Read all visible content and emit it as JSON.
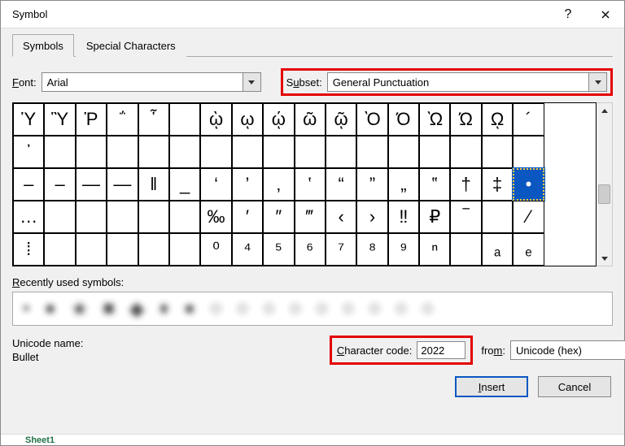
{
  "window": {
    "title": "Symbol"
  },
  "tabs": {
    "symbols": "Symbols",
    "special": "Special Characters"
  },
  "font": {
    "label": "Font:",
    "value": "Arial"
  },
  "subset": {
    "label": "Subset:",
    "value": "General Punctuation"
  },
  "grid": {
    "rows": [
      [
        "Ὑ",
        "Ὓ",
        "Ῥ",
        "΅",
        "῟",
        "",
        "ῲ",
        "ῳ",
        "ῴ",
        "ῶ",
        "ῷ",
        "Ὸ",
        "Ό",
        "Ὼ",
        "Ώ",
        "ῼ",
        "´"
      ],
      [
        "᾿",
        "",
        "",
        "",
        "",
        "",
        "",
        "",
        "",
        "",
        "",
        "",
        "",
        "",
        "",
        "",
        ""
      ],
      [
        "‒",
        "–",
        "—",
        "―",
        "‖",
        "_",
        "‘",
        "’",
        "‚",
        "‛",
        "“",
        "”",
        "„",
        "‟",
        "†",
        "‡",
        "•"
      ],
      [
        "…",
        "",
        "",
        "",
        "",
        "",
        "‰",
        "′",
        "″",
        "‴",
        "‹",
        "›",
        "‼",
        "₽",
        "‾",
        "",
        "⁄"
      ],
      [
        "⁞",
        "",
        "",
        "",
        "",
        "",
        "⁰",
        "⁴",
        "⁵",
        "⁶",
        "⁷",
        "⁸",
        "⁹",
        "ⁿ",
        "",
        "ₐ",
        "ₑ"
      ]
    ],
    "selected": {
      "row": 2,
      "col": 16
    }
  },
  "recent_label": "Recently used symbols:",
  "recent_placeholder_items": [
    "•",
    "●",
    "★",
    "■",
    "◆",
    "♦",
    "●",
    "○",
    "○",
    "○",
    "○",
    "○",
    "○",
    "○",
    "○",
    "○"
  ],
  "unicode_name_label": "Unicode name:",
  "unicode_name_value": "Bullet",
  "charcode": {
    "label": "Character code:",
    "value": "2022"
  },
  "from": {
    "label": "from:",
    "value": "Unicode (hex)"
  },
  "buttons": {
    "insert": "Insert",
    "cancel": "Cancel"
  },
  "footer": {
    "sheet_tab": "Sheet1"
  }
}
